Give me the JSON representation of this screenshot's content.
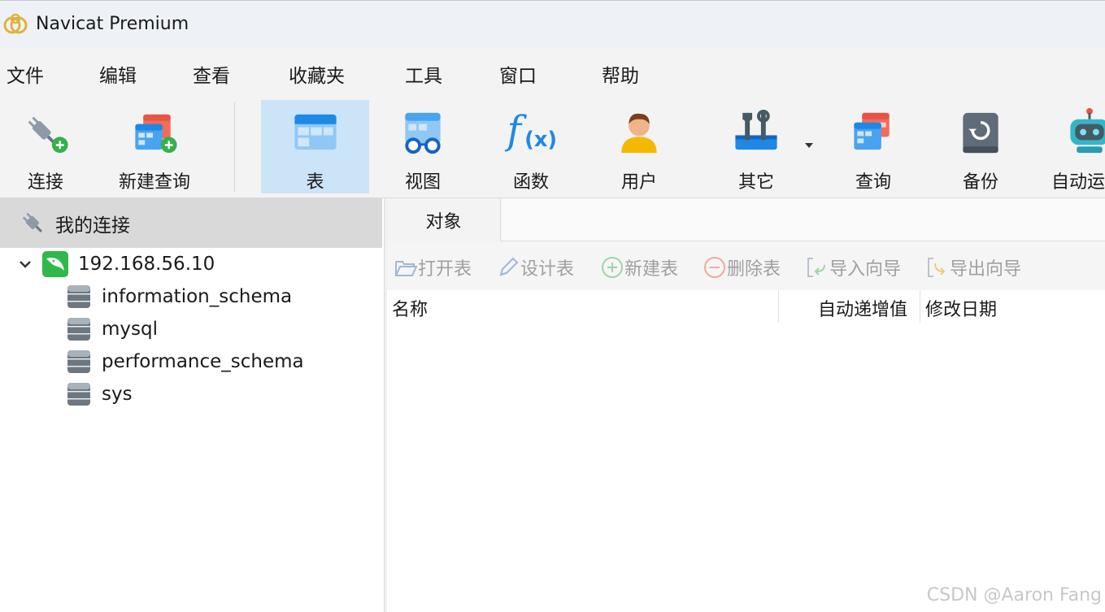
{
  "window": {
    "title": "Navicat Premium"
  },
  "menu": [
    "文件",
    "编辑",
    "查看",
    "收藏夹",
    "工具",
    "窗口",
    "帮助"
  ],
  "toolbar": {
    "connect": "连接",
    "new_query": "新建查询",
    "table": "表",
    "view": "视图",
    "function": "函数",
    "user": "用户",
    "other": "其它",
    "query": "查询",
    "backup": "备份",
    "automation": "自动运"
  },
  "sidebar": {
    "header": "我的连接",
    "connection": "192.168.56.10",
    "databases": [
      "information_schema",
      "mysql",
      "performance_schema",
      "sys"
    ]
  },
  "main": {
    "tab": "对象",
    "actions": {
      "open_table": "打开表",
      "design_table": "设计表",
      "new_table": "新建表",
      "delete_table": "删除表",
      "import_wizard": "导入向导",
      "export_wizard": "导出向导"
    },
    "columns": [
      "名称",
      "自动递增值",
      "修改日期"
    ]
  },
  "watermark": "CSDN @Aaron Fang",
  "colors": {
    "active_tool_bg": "#cce4f7",
    "accent_blue": "#1e88e5",
    "mysql_green": "#2fb94a"
  }
}
